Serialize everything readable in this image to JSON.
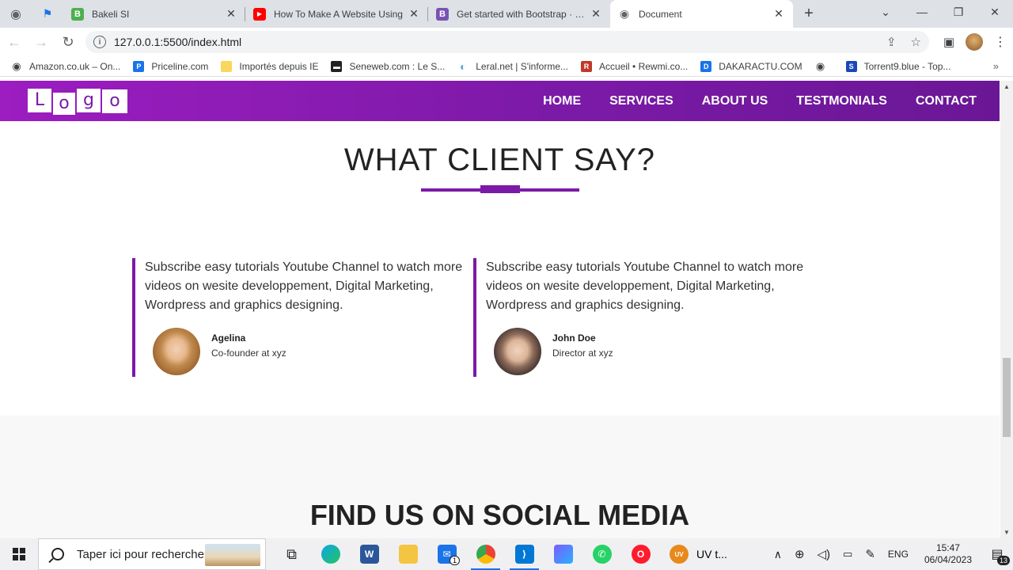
{
  "browser": {
    "tabs": [
      {
        "title": "Bakeli SI",
        "favicon_color": "#4caf50",
        "favicon": "B"
      },
      {
        "title": "How To Make A Website Using",
        "favicon_color": "#ff0000",
        "favicon": "▶"
      },
      {
        "title": "Get started with Bootstrap · Boo",
        "favicon_color": "#7952b3",
        "favicon": "B"
      },
      {
        "title": "Document",
        "favicon_color": "#5f6368",
        "favicon": "◉"
      }
    ],
    "new_tab": "+",
    "url": "127.0.0.1:5500/index.html",
    "bookmarks": [
      {
        "label": "Amazon.co.uk – On...",
        "color": "#3c4043",
        "icon": "◉"
      },
      {
        "label": "Priceline.com",
        "color": "#1a73e8",
        "icon": "P"
      },
      {
        "label": "Importés depuis IE",
        "color": "#f9d65c",
        "icon": ""
      },
      {
        "label": "Seneweb.com : Le S...",
        "color": "#222222",
        "icon": "▬"
      },
      {
        "label": "Leral.net | S'informe...",
        "color": "#5aa9d6",
        "icon": "◐"
      },
      {
        "label": "Accueil • Rewmi.co...",
        "color": "#c0392b",
        "icon": "R"
      },
      {
        "label": "DAKARACTU.COM",
        "color": "#1a73e8",
        "icon": "D"
      },
      {
        "label": "",
        "color": "#3c4043",
        "icon": "◉"
      },
      {
        "label": "Torrent9.blue - Top...",
        "color": "#1a47b8",
        "icon": "S"
      }
    ]
  },
  "site": {
    "logo": [
      "L",
      "o",
      "g",
      "o"
    ],
    "menu": [
      "HOME",
      "SERVICES",
      "ABOUT US",
      "TESTMONIALS",
      "CONTACT"
    ],
    "heading": "WHAT CLIENT SAY?",
    "testimonials": [
      {
        "text": "Subscribe easy tutorials Youtube Channel to watch more videos on wesite developpement, Digital Marketing, Wordpress and graphics designing.",
        "name": "Agelina",
        "role": "Co-founder at xyz"
      },
      {
        "text": "Subscribe easy tutorials Youtube Channel to watch more videos on wesite developpement, Digital Marketing, Wordpress and graphics designing.",
        "name": "John Doe",
        "role": "Director at xyz"
      }
    ],
    "social_heading": "FIND US ON SOCIAL MEDIA"
  },
  "taskbar": {
    "search_placeholder": "Taper ici pour rechercher",
    "tray_app": "UV t...",
    "language": "ENG",
    "time": "15:47",
    "date": "06/04/2023",
    "notifications": "13",
    "mail_badge": "1"
  }
}
